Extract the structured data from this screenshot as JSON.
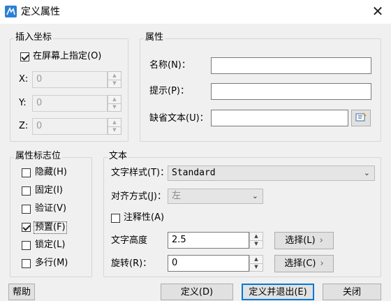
{
  "window": {
    "title": "定义属性",
    "close_glyph": "✕"
  },
  "insertion": {
    "legend": "插入坐标",
    "on_screen_label": "在屏幕上指定(O)",
    "on_screen_checked": true,
    "fields": [
      {
        "label": "X:",
        "value": "0"
      },
      {
        "label": "Y:",
        "value": "0"
      },
      {
        "label": "Z:",
        "value": "0"
      }
    ]
  },
  "attribute": {
    "legend": "属性",
    "name_label": "名称(N)：",
    "name_value": "",
    "prompt_label": "提示(P)：",
    "prompt_value": "",
    "default_label": "缺省文本(U)：",
    "default_value": "",
    "field_button_icon": "insert-field-icon"
  },
  "flags": {
    "legend": "属性标志位",
    "items": [
      {
        "label": "隐藏(H)",
        "checked": false
      },
      {
        "label": "固定(I)",
        "checked": false
      },
      {
        "label": "验证(V)",
        "checked": false
      },
      {
        "label": "预置(F)",
        "checked": true
      },
      {
        "label": "锁定(L)",
        "checked": false
      },
      {
        "label": "多行(M)",
        "checked": false
      }
    ]
  },
  "text": {
    "legend": "文本",
    "style_label": "文字样式(T)：",
    "style_value": "Standard",
    "align_label": "对齐方式(J)：",
    "align_value": "左",
    "annotative_label": "注释性(A)",
    "annotative_checked": false,
    "height_label": "文字高度",
    "height_value": "2.5",
    "rotation_label": "旋转(R)：",
    "rotation_value": "0",
    "pick_height_label": "选择(L)",
    "pick_rotation_label": "选择(C)",
    "chevron": "›"
  },
  "buttons": {
    "help": "帮助",
    "ok": "定义(D)",
    "ok_exit": "定义并退出(E)",
    "close": "关闭"
  }
}
